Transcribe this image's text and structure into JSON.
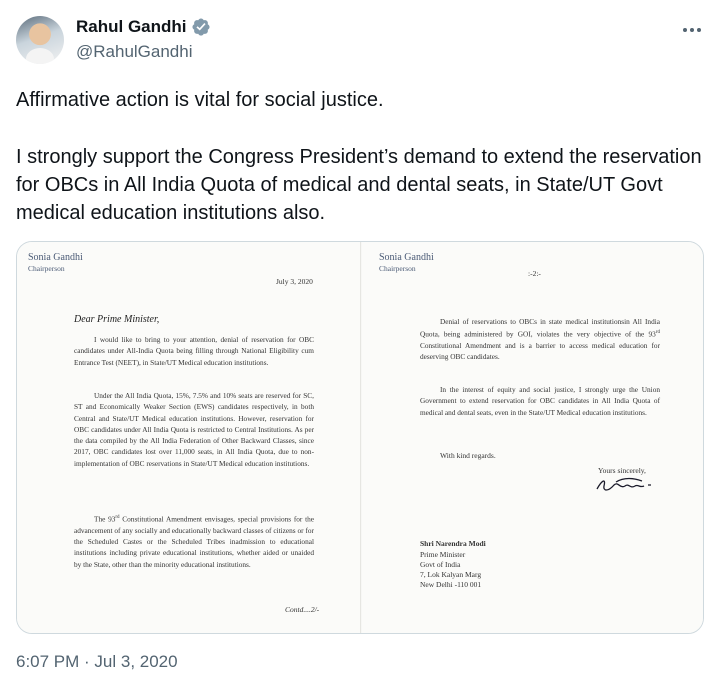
{
  "author": {
    "display_name": "Rahul Gandhi",
    "handle": "@RahulGandhi",
    "verified_color": "#829aab"
  },
  "tweet": {
    "paragraphs": [
      "Affirmative action is vital for social justice.",
      "I strongly support the Congress President’s demand to extend the reservation for OBCs in All India Quota of medical and dental seats, in State/UT Govt medical education institutions also."
    ],
    "time": "6:07 PM",
    "separator": " · ",
    "date": "Jul 3, 2020"
  },
  "letter": {
    "page1": {
      "sender": "Sonia Gandhi",
      "sender_role": "Chairperson",
      "date": "July 3, 2020",
      "salutation": "Dear Prime Minister,",
      "p1": "I would like to bring to your attention, denial of reservation for OBC candidates under All-India Quota being filling through National Eligibility cum Entrance Test (NEET), in State/UT Medical education institutions.",
      "p2": "Under the All India Quota, 15%, 7.5% and 10% seats are reserved for SC, ST and Economically Weaker Section (EWS) candidates respectively, in both Central and State/UT Medical education institutions. However, reservation for OBC candidates under All India Quota is restricted to Central Institutions. As per the data compiled by the All India Federation of Other Backward Classes, since 2017, OBC candidates lost over 11,000 seats, in All India Quota, due to non-implementation of OBC reservations in State/UT Medical education institutions.",
      "p3_pre": "The 93",
      "p3_sup": "rd",
      "p3_post": " Constitutional Amendment envisages, special provisions for the advancement of any socially and educationally backward classes of citizens or for the Scheduled Castes or the Scheduled Tribes inadmission to educational institutions including private educational institutions, whether aided or unaided by the State, other than the minority educational institutions.",
      "contd": "Contd....2/-"
    },
    "page2": {
      "sender": "Sonia Gandhi",
      "sender_role": "Chairperson",
      "page_no": ":-2:-",
      "p1_pre": "Denial of reservations to OBCs in state medical institutionsin All India Quota, being administered by GOI, violates the very objective of the 93",
      "p1_sup": "rd",
      "p1_post": " Constitutional Amendment and is a barrier to access medical education for deserving OBC candidates.",
      "p2": "In the interest of equity and social justice, I strongly urge the Union Government to extend reservation for OBC candidates in All India Quota of medical and dental seats, even in the State/UT Medical education institutions.",
      "closing": "With kind regards.",
      "yours": "Yours sincerely,",
      "addressee_name": "Shri Narendra Modi",
      "addressee_lines": [
        "Prime Minister",
        "Govt of India",
        "7, Lok Kalyan Marg",
        "New Delhi -110 001"
      ]
    }
  }
}
